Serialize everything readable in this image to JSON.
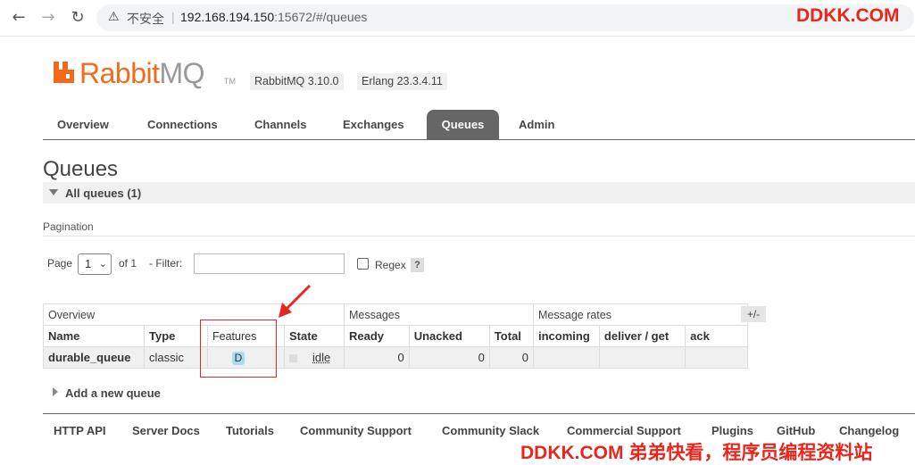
{
  "browser": {
    "back_icon": "arrow-left-icon",
    "forward_icon": "arrow-right-icon",
    "reload_icon": "reload-icon",
    "security_icon": "warning-icon",
    "security_label": "不安全",
    "url_host": "192.168.194.150",
    "url_rest": ":15672/#/queues"
  },
  "watermark_top": "DDKK.COM",
  "watermark_bottom": "DDKK.COM 弟弟快看，程序员编程资料站",
  "brand": {
    "name_rabbit": "Rabbit",
    "name_mq": "MQ",
    "tm": "TM",
    "rabbitmq_version": "RabbitMQ 3.10.0",
    "erlang_version": "Erlang 23.3.4.11",
    "accent_color": "#f36a1a"
  },
  "tabs": [
    "Overview",
    "Connections",
    "Channels",
    "Exchanges",
    "Queues",
    "Admin"
  ],
  "active_tab": "Queues",
  "page_title": "Queues",
  "section_title": "All queues (1)",
  "pagination": {
    "label": "Pagination",
    "page_label": "Page",
    "page_value": "1",
    "of_label": "of 1",
    "filter_label": "- Filter:",
    "filter_value": "",
    "regex_label": "Regex",
    "regex_checked": false,
    "help_label": "?"
  },
  "table": {
    "groups": [
      "Overview",
      "Messages",
      "Message rates"
    ],
    "columns": [
      "Name",
      "Type",
      "Features",
      "State",
      "Ready",
      "Unacked",
      "Total",
      "incoming",
      "deliver / get",
      "ack"
    ],
    "toggle_label": "+/-",
    "rows": [
      {
        "name": "durable_queue",
        "type": "classic",
        "features": "D",
        "state": "idle",
        "ready": "0",
        "unacked": "0",
        "total": "0",
        "incoming": "",
        "deliver_get": "",
        "ack": ""
      }
    ]
  },
  "add_queue_label": "Add a new queue",
  "footer_links": [
    "HTTP API",
    "Server Docs",
    "Tutorials",
    "Community Support",
    "Community Slack",
    "Commercial Support",
    "Plugins",
    "GitHub",
    "Changelog"
  ],
  "annotation_color": "#e8261c"
}
